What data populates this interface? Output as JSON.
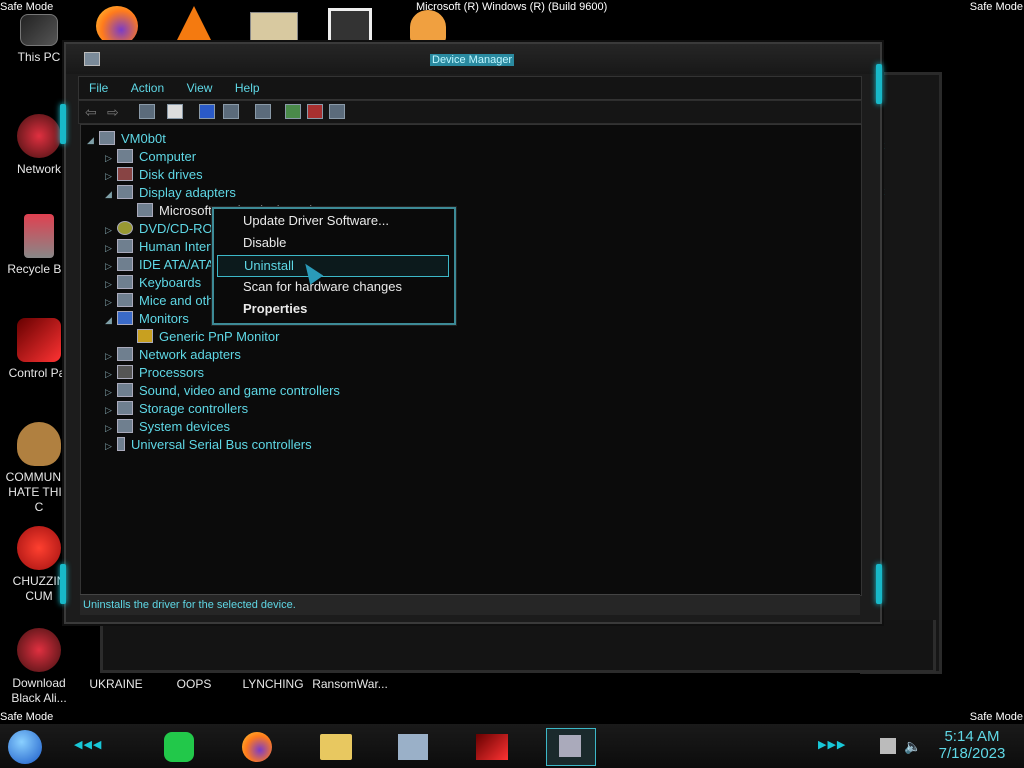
{
  "desktop": {
    "safe_mode": "Safe Mode",
    "os_title": "Microsoft (R) Windows (R) (Build 9600)",
    "icons_left": [
      {
        "label": "This PC"
      },
      {
        "label": "Network"
      },
      {
        "label": "Recycle Bin"
      },
      {
        "label": "Control Par"
      },
      {
        "label": "COMMUNIS HATE THIS C"
      },
      {
        "label": "CHUZZIN CUM"
      },
      {
        "label": "Download Black Ali..."
      }
    ],
    "icons_bottom": [
      {
        "label": "UKRAINE"
      },
      {
        "label": "OOPS"
      },
      {
        "label": "LYNCHING"
      },
      {
        "label": "RansomWar..."
      }
    ]
  },
  "window": {
    "title": "Device Manager",
    "menu": [
      "File",
      "Action",
      "View",
      "Help"
    ],
    "status_text": "Uninstalls the driver for the selected device.",
    "tree": {
      "root": "VM0b0t",
      "items": [
        {
          "label": "Computer",
          "expanded": false
        },
        {
          "label": "Disk drives",
          "expanded": false
        },
        {
          "label": "Display adapters",
          "expanded": true
        },
        {
          "label": "Microsoft Basic Display Adapter",
          "child": true
        },
        {
          "label": "DVD/CD-ROM drives",
          "expanded": false
        },
        {
          "label": "Human Interface Devices",
          "expanded": false
        },
        {
          "label": "IDE ATA/ATAPI controllers",
          "expanded": false
        },
        {
          "label": "Keyboards",
          "expanded": false
        },
        {
          "label": "Mice and other pointing devices",
          "expanded": false
        },
        {
          "label": "Monitors",
          "expanded": true
        },
        {
          "label": "Generic PnP Monitor",
          "child": true
        },
        {
          "label": "Network adapters",
          "expanded": false
        },
        {
          "label": "Processors",
          "expanded": false
        },
        {
          "label": "Sound, video and game controllers",
          "expanded": false
        },
        {
          "label": "Storage controllers",
          "expanded": false
        },
        {
          "label": "System devices",
          "expanded": false
        },
        {
          "label": "Universal Serial Bus controllers",
          "expanded": false
        }
      ]
    }
  },
  "context_menu": {
    "items": [
      {
        "label": "Update Driver Software..."
      },
      {
        "label": "Disable"
      },
      {
        "label": "Uninstall",
        "selected": true
      },
      {
        "label": "Scan for hardware changes"
      },
      {
        "label": "Properties",
        "bold": true
      }
    ]
  },
  "taskbar": {
    "time": "5:14 AM",
    "date": "7/18/2023"
  },
  "colors": {
    "accent": "#5fd8e6",
    "teal_glow": "#18b8c8"
  }
}
